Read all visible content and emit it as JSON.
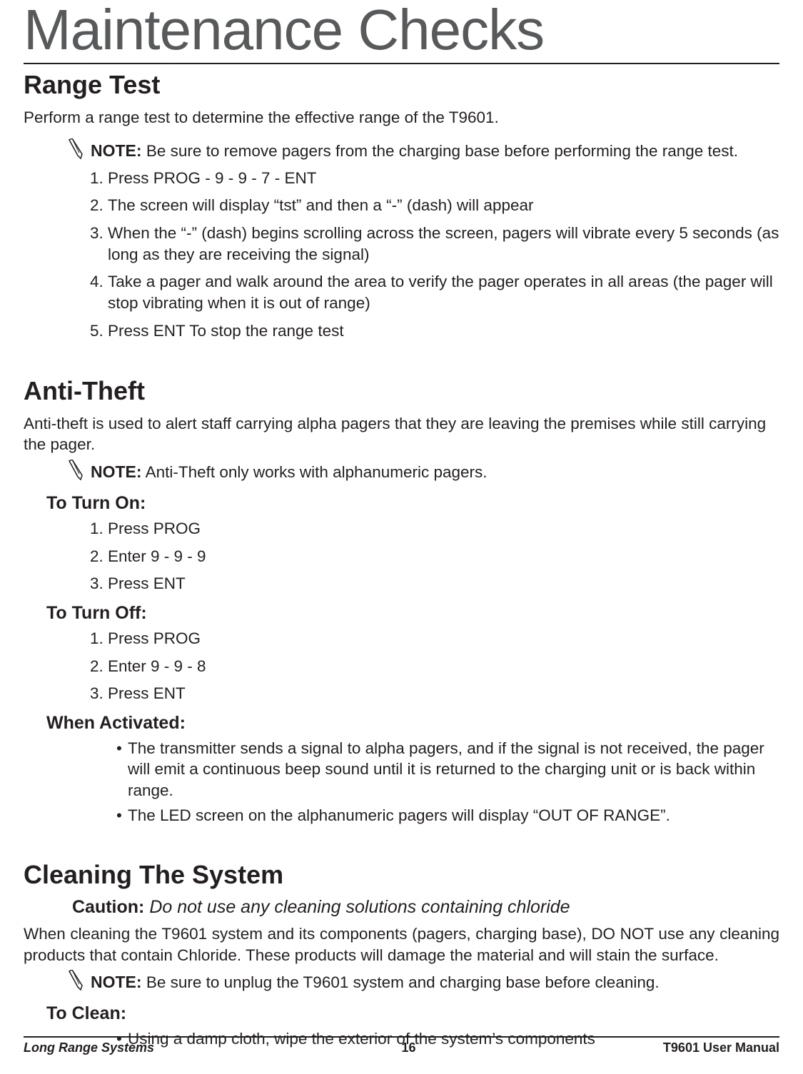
{
  "title": "Maintenance Checks",
  "range_test": {
    "heading": "Range Test",
    "intro": "Perform a range test to determine the effective range of the T9601.",
    "note_label": "NOTE:",
    "note_text": " Be sure to remove pagers from the charging base before performing the range test.",
    "steps": [
      "Press PROG - 9 - 9 - 7 - ENT",
      "The screen will display “tst” and then a “-” (dash) will appear",
      "When the “-” (dash) begins scrolling across the screen, pagers will vibrate every 5 seconds (as long as they are receiving the signal)",
      "Take a pager and walk around the area to verify the pager operates in all areas (the pager will stop vibrating when it is out of range)",
      "Press ENT To stop the range test"
    ]
  },
  "anti_theft": {
    "heading": "Anti-Theft",
    "intro": "Anti-theft is used to alert staff carrying alpha pagers that they are leaving the premises while still carrying the pager.",
    "note_label": "NOTE:",
    "note_text": " Anti-Theft only works with alphanumeric pagers.",
    "turn_on_heading": "To Turn On:",
    "turn_on_steps": [
      "Press PROG",
      "Enter 9 - 9 - 9",
      "Press ENT"
    ],
    "turn_off_heading": "To Turn Off:",
    "turn_off_steps": [
      "Press PROG",
      "Enter 9 - 9 - 8",
      "Press ENT"
    ],
    "activated_heading": "When Activated:",
    "activated_bullets": [
      "The transmitter sends a signal to alpha pagers, and if the signal is not received, the pager will emit a continuous beep sound until it is returned to the charging unit or is back within range.",
      "The LED screen on the alphanumeric pagers will display “OUT OF RANGE”."
    ]
  },
  "cleaning": {
    "heading": "Cleaning The System",
    "caution_label": "Caution:",
    "caution_text": " Do not use any cleaning solutions containing chloride",
    "intro": "When cleaning the T9601 system and its components (pagers, charging base), DO NOT use any cleaning products that contain Chloride. These products will damage the material and will stain the surface.",
    "note_label": "NOTE:",
    "note_text": " Be sure to unplug the T9601 system and charging base before cleaning.",
    "to_clean_heading": "To Clean:",
    "to_clean_bullets": [
      "Using a damp cloth, wipe the exterior of the system’s components"
    ]
  },
  "footer": {
    "left": "Long Range Systems",
    "center": "16",
    "right": "T9601 User Manual"
  }
}
